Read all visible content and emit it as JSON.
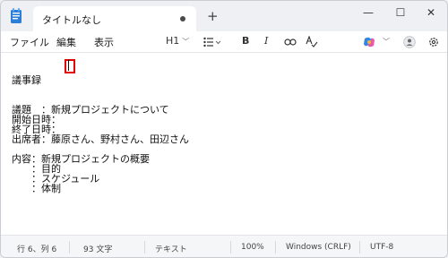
{
  "tab": {
    "title": "タイトルなし",
    "new_tab": "+"
  },
  "window_controls": {
    "minimize": "—",
    "maximize": "☐",
    "close": "✕"
  },
  "menu": [
    "ファイル",
    "編集",
    "表示"
  ],
  "toolbar": {
    "heading": "H1",
    "bold": "B",
    "italic": "I"
  },
  "document": {
    "lines": [
      "議事録",
      "",
      "議題　：新規プロジェクトについて",
      "開始日時：",
      "終了日時：",
      "出席者：藤原さん、野村さん、田辺さん",
      "",
      "内容：新規プロジェクトの概要",
      "　　：目的",
      "　　：スケジュール",
      "　　：体制"
    ]
  },
  "status": {
    "position": "行 6、列 6",
    "chars": "93 文字",
    "format": "テキスト",
    "zoom": "100%",
    "line_ending": "Windows (CRLF)",
    "encoding": "UTF-8"
  },
  "colors": {
    "highlight_box": "#e00000",
    "accent": "#2b6fd6"
  }
}
